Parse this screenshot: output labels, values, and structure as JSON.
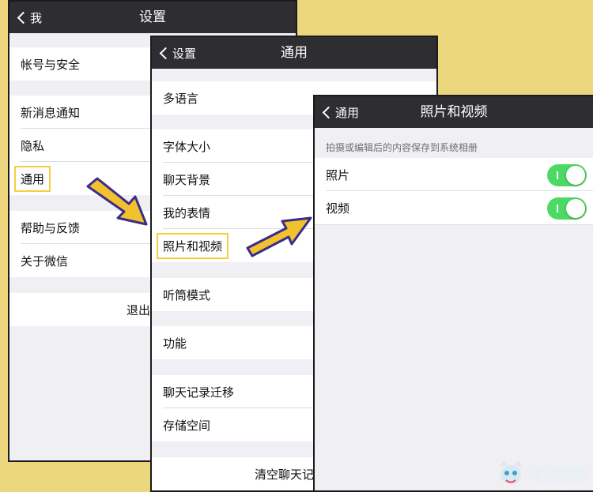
{
  "screen1": {
    "back_label": "我",
    "title": "设置",
    "rows": {
      "account": "帐号与安全",
      "notify": "新消息通知",
      "privacy": "隐私",
      "general": "通用",
      "help": "帮助与反馈",
      "about": "关于微信",
      "logout": "退出"
    }
  },
  "screen2": {
    "back_label": "设置",
    "title": "通用",
    "rows": {
      "language": "多语言",
      "font_size": "字体大小",
      "chat_bg": "聊天背景",
      "stickers": "我的表情",
      "photos_videos": "照片和视频",
      "earpiece": "听筒模式",
      "features": "功能",
      "chat_migrate": "聊天记录迁移",
      "storage": "存储空间",
      "clear_chat": "清空聊天记"
    }
  },
  "screen3": {
    "back_label": "通用",
    "title": "照片和视频",
    "caption": "拍摄或编辑后的内容保存到系统相册",
    "rows": {
      "photos": "照片",
      "videos": "视频"
    },
    "toggles": {
      "photos": true,
      "videos": true
    }
  },
  "colors": {
    "highlight": "#f4d03f",
    "arrow": "#f2c12e",
    "toggle_on": "#4cd964",
    "navbar": "#2e2e32",
    "background": "#ecd67e"
  },
  "watermark": {
    "text": "牛游戏网",
    "url": "www.newyx.net"
  }
}
